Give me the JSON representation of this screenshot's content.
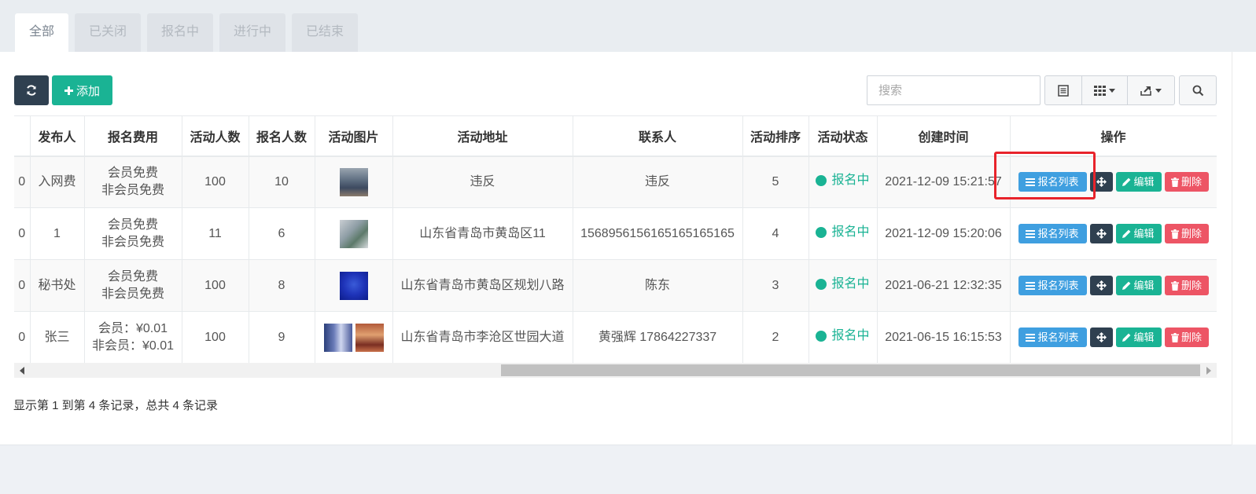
{
  "tabs": [
    "全部",
    "已关闭",
    "报名中",
    "进行中",
    "已结束"
  ],
  "toolbar": {
    "refresh_icon": "refresh-icon",
    "add_label": "添加",
    "search_placeholder": "搜索"
  },
  "table": {
    "columns": [
      "",
      "发布人",
      "报名费用",
      "活动人数",
      "报名人数",
      "活动图片",
      "活动地址",
      "联系人",
      "活动排序",
      "活动状态",
      "创建时间",
      "操作"
    ],
    "rows": [
      {
        "first": "0",
        "publisher": "入网费",
        "fee1": "会员免费",
        "fee2": "非会员免费",
        "capacity": "100",
        "signed": "10",
        "address": "违反",
        "contact": "违反",
        "sort": "5",
        "status": "报名中",
        "created": "2021-12-09 15:21:57"
      },
      {
        "first": "0",
        "publisher": "1",
        "fee1": "会员免费",
        "fee2": "非会员免费",
        "capacity": "11",
        "signed": "6",
        "address": "山东省青岛市黄岛区11",
        "contact": "156895615616516516516 5",
        "sort": "4",
        "status": "报名中",
        "created": "2021-12-09 15:20:06"
      },
      {
        "first": "0",
        "publisher": "秘书处",
        "fee1": "会员免费",
        "fee2": "非会员免费",
        "capacity": "100",
        "signed": "8",
        "address": "山东省青岛市黄岛区规划八路",
        "contact": "陈东",
        "sort": "3",
        "status": "报名中",
        "created": "2021-06-21 12:32:35"
      },
      {
        "first": "0",
        "publisher": "张三",
        "fee1": "会员：¥0.01",
        "fee2": "非会员：¥0.01",
        "capacity": "100",
        "signed": "9",
        "address": "山东省青岛市李沧区世园大道",
        "contact": "黄强辉 17864227337",
        "sort": "2",
        "status": "报名中",
        "created": "2021-06-15 16:15:53"
      }
    ],
    "actions": {
      "list": "报名列表",
      "edit": "编辑",
      "delete": "删除"
    }
  },
  "footer": "显示第 1 到第 4 条记录，总共 4 条记录",
  "colors": {
    "primary": "#2f4050",
    "green": "#1ab394",
    "blue": "#3f9fe0",
    "red": "#ed5565",
    "highlight": "#e8232b"
  }
}
